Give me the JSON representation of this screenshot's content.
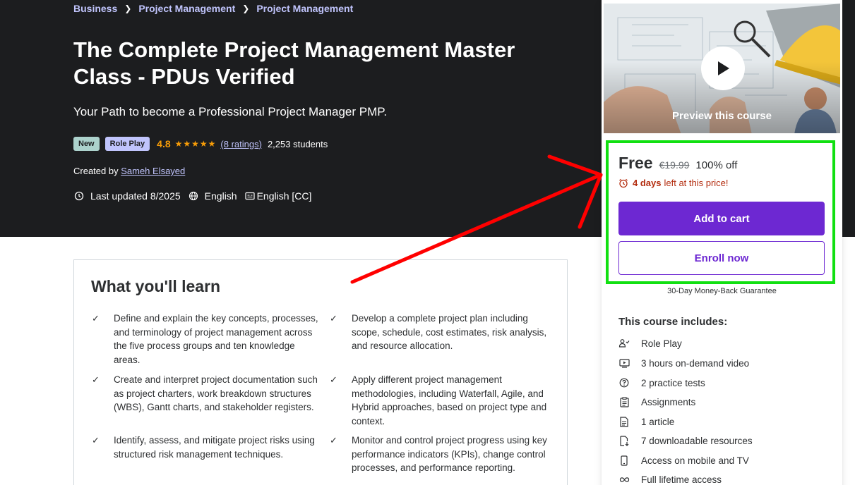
{
  "breadcrumb": {
    "items": [
      "Business",
      "Project Management",
      "Project Management"
    ]
  },
  "course": {
    "title": "The Complete Project Management Master Class - PDUs Verified",
    "subtitle": "Your Path to become a Professional Project Manager PMP.",
    "badges": {
      "new": "New",
      "role_play": "Role Play"
    },
    "rating": "4.8",
    "rating_value": 4.8,
    "stars": "★★★★★",
    "ratings_count": "(8 ratings)",
    "students": "2,253 students",
    "created_by_label": "Created by",
    "author": "Sameh Elsayed",
    "last_updated": "Last updated 8/2025",
    "language": "English",
    "captions": "English [CC]"
  },
  "learn": {
    "title": "What you'll learn",
    "items": [
      "Define and explain the key concepts, processes, and terminology of project management across the five process groups and ten knowledge areas.",
      "Develop a complete project plan including scope, schedule, cost estimates, risk analysis, and resource allocation.",
      "Create and interpret project documentation such as project charters, work breakdown structures (WBS), Gantt charts, and stakeholder registers.",
      "Apply different project management methodologies, including Waterfall, Agile, and Hybrid approaches, based on project type and context.",
      "Identify, assess, and mitigate project risks using structured risk management techniques.",
      "Monitor and control project progress using key performance indicators (KPIs), change control processes, and performance reporting."
    ]
  },
  "sidebar": {
    "preview_label": "Preview this course",
    "price": "Free",
    "original_price": "€19.99",
    "discount": "100% off",
    "timer_bold": "4 days",
    "timer_rest": "left at this price!",
    "add_to_cart": "Add to cart",
    "enroll_now": "Enroll now",
    "guarantee": "30-Day Money-Back Guarantee",
    "includes_title": "This course includes:",
    "includes": [
      {
        "icon": "role-play-icon",
        "label": "Role Play"
      },
      {
        "icon": "video-icon",
        "label": "3 hours on-demand video"
      },
      {
        "icon": "question-icon",
        "label": "2 practice tests"
      },
      {
        "icon": "assignment-icon",
        "label": "Assignments"
      },
      {
        "icon": "article-icon",
        "label": "1 article"
      },
      {
        "icon": "download-icon",
        "label": "7 downloadable resources"
      },
      {
        "icon": "mobile-icon",
        "label": "Access on mobile and TV"
      },
      {
        "icon": "infinity-icon",
        "label": "Full lifetime access"
      }
    ]
  },
  "colors": {
    "hero_bg": "#1c1d1f",
    "accent_purple": "#6d28d2",
    "link_lavender": "#c0c4fc",
    "star_orange": "#f69c08",
    "timer_red": "#b32d0f",
    "highlight_green": "#11e011",
    "annotation_red": "#ff0000"
  }
}
